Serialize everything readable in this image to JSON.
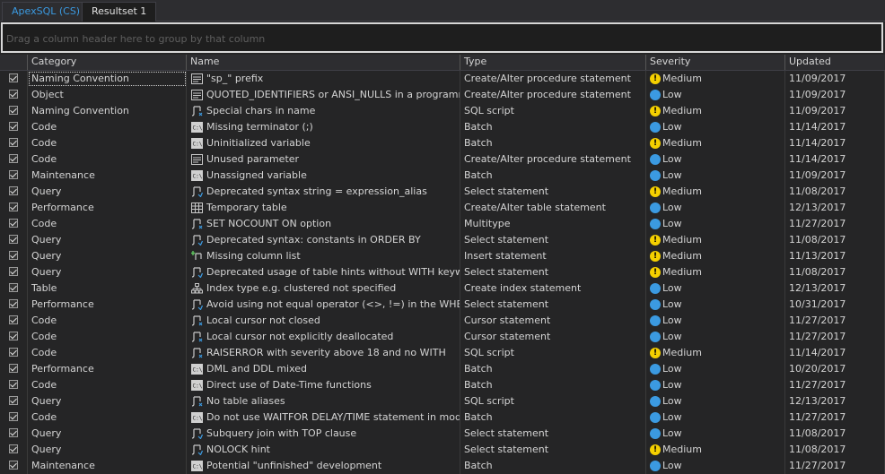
{
  "tabs": [
    "ApexSQL (CS)",
    "Resultset 1"
  ],
  "group_placeholder": "Drag a column header here to group by that column",
  "columns": [
    "Category",
    "Name",
    "Type",
    "Severity",
    "Updated"
  ],
  "rows": [
    {
      "category": "Naming Convention",
      "name": "\"sp_\" prefix",
      "icon": "proc-icon",
      "type": "Create/Alter procedure statement",
      "severity": "Medium",
      "updated": "11/09/2017"
    },
    {
      "category": "Object",
      "name": "QUOTED_IDENTIFIERS or ANSI_NULLS in a programma...",
      "icon": "proc-icon",
      "type": "Create/Alter procedure statement",
      "severity": "Low",
      "updated": "11/09/2017"
    },
    {
      "category": "Naming Convention",
      "name": "Special chars in name",
      "icon": "script-icon",
      "type": "SQL script",
      "severity": "Medium",
      "updated": "11/09/2017"
    },
    {
      "category": "Code",
      "name": "Missing terminator (;)",
      "icon": "batch-icon",
      "type": "Batch",
      "severity": "Low",
      "updated": "11/14/2017"
    },
    {
      "category": "Code",
      "name": "Uninitialized variable",
      "icon": "batch-icon",
      "type": "Batch",
      "severity": "Medium",
      "updated": "11/14/2017"
    },
    {
      "category": "Code",
      "name": "Unused parameter",
      "icon": "proc-icon",
      "type": "Create/Alter procedure statement",
      "severity": "Low",
      "updated": "11/14/2017"
    },
    {
      "category": "Maintenance",
      "name": "Unassigned variable",
      "icon": "batch-icon",
      "type": "Batch",
      "severity": "Low",
      "updated": "11/09/2017"
    },
    {
      "category": "Query",
      "name": "Deprecated syntax string = expression_alias",
      "icon": "select-icon",
      "type": "Select statement",
      "severity": "Medium",
      "updated": "11/08/2017"
    },
    {
      "category": "Performance",
      "name": "Temporary table",
      "icon": "table-icon",
      "type": "Create/Alter table statement",
      "severity": "Low",
      "updated": "12/13/2017"
    },
    {
      "category": "Code",
      "name": "SET NOCOUNT ON option",
      "icon": "script-icon",
      "type": "Multitype",
      "severity": "Low",
      "updated": "11/27/2017"
    },
    {
      "category": "Query",
      "name": "Deprecated syntax: constants in ORDER BY",
      "icon": "select-icon",
      "type": "Select statement",
      "severity": "Medium",
      "updated": "11/08/2017"
    },
    {
      "category": "Query",
      "name": "Missing column list",
      "icon": "insert-icon",
      "type": "Insert statement",
      "severity": "Medium",
      "updated": "11/13/2017"
    },
    {
      "category": "Query",
      "name": "Deprecated usage of table hints without WITH keyword",
      "icon": "select-icon",
      "type": "Select statement",
      "severity": "Medium",
      "updated": "11/08/2017"
    },
    {
      "category": "Table",
      "name": "Index type e.g. clustered not specified",
      "icon": "index-icon",
      "type": "Create index statement",
      "severity": "Low",
      "updated": "12/13/2017"
    },
    {
      "category": "Performance",
      "name": "Avoid using not equal operator (<>, !=) in the WHERE...",
      "icon": "select-icon",
      "type": "Select statement",
      "severity": "Low",
      "updated": "10/31/2017"
    },
    {
      "category": "Code",
      "name": "Local cursor not closed",
      "icon": "script-icon",
      "type": "Cursor statement",
      "severity": "Low",
      "updated": "11/27/2017"
    },
    {
      "category": "Code",
      "name": "Local cursor not explicitly deallocated",
      "icon": "script-icon",
      "type": "Cursor statement",
      "severity": "Low",
      "updated": "11/27/2017"
    },
    {
      "category": "Code",
      "name": "RAISERROR with severity above 18 and no WITH",
      "icon": "script-icon",
      "type": "SQL script",
      "severity": "Medium",
      "updated": "11/14/2017"
    },
    {
      "category": "Performance",
      "name": "DML and DDL mixed",
      "icon": "batch-icon",
      "type": "Batch",
      "severity": "Low",
      "updated": "10/20/2017"
    },
    {
      "category": "Code",
      "name": "Direct use of Date-Time functions",
      "icon": "batch-icon",
      "type": "Batch",
      "severity": "Low",
      "updated": "11/27/2017"
    },
    {
      "category": "Query",
      "name": "No table aliases",
      "icon": "script-icon",
      "type": "SQL script",
      "severity": "Low",
      "updated": "12/13/2017"
    },
    {
      "category": "Code",
      "name": "Do not use WAITFOR DELAY/TIME statement in modules",
      "icon": "batch-icon",
      "type": "Batch",
      "severity": "Low",
      "updated": "11/27/2017"
    },
    {
      "category": "Query",
      "name": "Subquery join with TOP clause",
      "icon": "select-icon",
      "type": "Select statement",
      "severity": "Low",
      "updated": "11/08/2017"
    },
    {
      "category": "Query",
      "name": "NOLOCK hint",
      "icon": "select-icon",
      "type": "Select statement",
      "severity": "Medium",
      "updated": "11/08/2017"
    },
    {
      "category": "Maintenance",
      "name": "Potential \"unfinished\" development",
      "icon": "batch-icon",
      "type": "Batch",
      "severity": "Low",
      "updated": "11/27/2017"
    }
  ]
}
